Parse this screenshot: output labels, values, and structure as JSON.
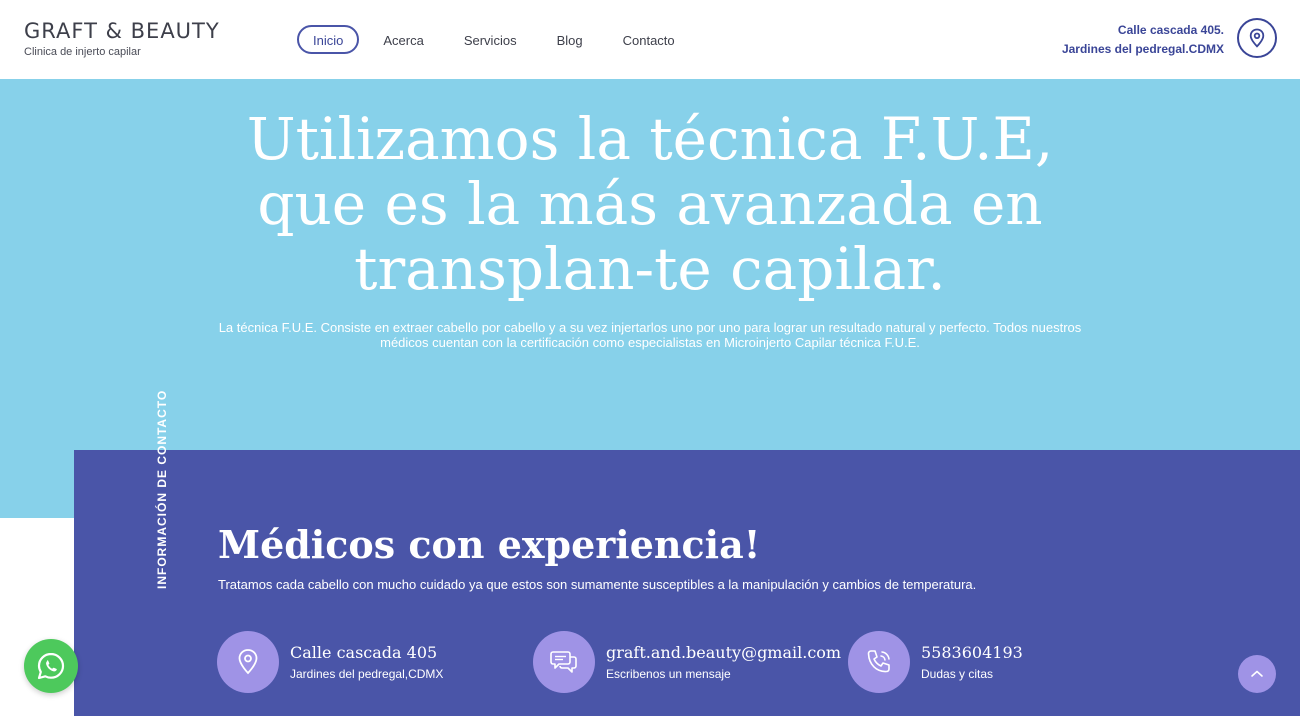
{
  "header": {
    "brand_title": "GRAFT & BEAUTY",
    "brand_subtitle": "Clinica de injerto capilar",
    "nav": [
      {
        "label": "Inicio",
        "active": true
      },
      {
        "label": "Acerca",
        "active": false
      },
      {
        "label": "Servicios",
        "active": false
      },
      {
        "label": "Blog",
        "active": false
      },
      {
        "label": "Contacto",
        "active": false
      }
    ],
    "address_line1": "Calle cascada 405.",
    "address_line2": "Jardines del pedregal.CDMX",
    "location_icon": "map-pin-icon"
  },
  "hero": {
    "title": "Utilizamos la técnica F.U.E, que es la más avanzada en transplan-te capilar.",
    "text": "La técnica F.U.E. Consiste en extraer cabello por cabello y a su vez injertarlos uno por uno para lograr un resultado natural y perfecto. Todos nuestros médicos cuentan con la certificación como especialistas en Microinjerto Capilar técnica F.U.E.",
    "background": "#87d1ea"
  },
  "contact_section": {
    "vertical_label": "INFORMACIÓN DE CONTACTO",
    "title": "Médicos con experiencia!",
    "text": "Tratamos cada cabello con mucho cuidado ya que estos son sumamente susceptibles a la manipulación y cambios de temperatura.",
    "background": "#4a55a8",
    "items": [
      {
        "icon": "map-pin-icon",
        "main": "Calle cascada 405",
        "sub": "Jardines del pedregal,CDMX"
      },
      {
        "icon": "chat-bubbles-icon",
        "main": "graft.and.beauty@gmail.com",
        "sub": "Escribenos un mensaje"
      },
      {
        "icon": "phone-icon",
        "main": "5583604193",
        "sub": "Dudas y citas"
      }
    ]
  },
  "floating": {
    "whatsapp_icon": "whatsapp-icon",
    "scroll_top_icon": "chevron-up-icon",
    "accent": "#9f93e6",
    "whatsapp_color": "#4dc95c"
  }
}
